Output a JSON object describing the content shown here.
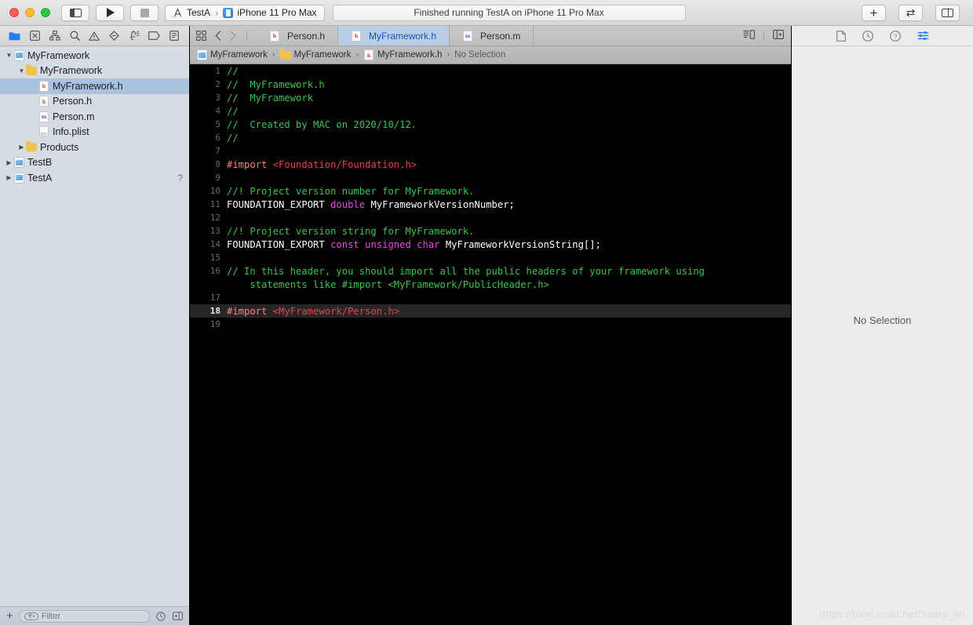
{
  "titlebar": {
    "traffic_lights": [
      "close",
      "minimize",
      "maximize"
    ],
    "sidebar_toggle_icon": "left-panel-icon",
    "run_button_label": "Run",
    "stop_button_label": "Stop",
    "scheme": {
      "project": "TestA",
      "separator": "›",
      "destination": "iPhone 11 Pro Max",
      "project_icon": "xcode-project-icon",
      "destination_icon": "simulator-icon"
    },
    "status": "Finished running TestA on iPhone 11 Pro Max",
    "add_button": "+",
    "swap_button": "⇄",
    "right_panel_toggle_icon": "right-panel-icon"
  },
  "navigator": {
    "toolbar_icons": [
      "project-navigator-icon",
      "source-control-navigator-icon",
      "symbol-navigator-icon",
      "find-navigator-icon",
      "issue-navigator-icon",
      "test-navigator-icon",
      "debug-navigator-icon",
      "breakpoint-navigator-icon",
      "report-navigator-icon"
    ],
    "tree": [
      {
        "label": "MyFramework",
        "icon": "project-icon",
        "indent": 0,
        "twist": "open",
        "selected": false,
        "badge": ""
      },
      {
        "label": "MyFramework",
        "icon": "folder-icon",
        "indent": 1,
        "twist": "open",
        "selected": false,
        "badge": ""
      },
      {
        "label": "MyFramework.h",
        "icon": "header-file-icon",
        "indent": 2,
        "twist": "none",
        "selected": true,
        "badge": ""
      },
      {
        "label": "Person.h",
        "icon": "header-file-icon",
        "indent": 2,
        "twist": "none",
        "selected": false,
        "badge": ""
      },
      {
        "label": "Person.m",
        "icon": "impl-file-icon",
        "indent": 2,
        "twist": "none",
        "selected": false,
        "badge": ""
      },
      {
        "label": "Info.plist",
        "icon": "plist-file-icon",
        "indent": 2,
        "twist": "none",
        "selected": false,
        "badge": ""
      },
      {
        "label": "Products",
        "icon": "folder-icon",
        "indent": 1,
        "twist": "closed",
        "selected": false,
        "badge": ""
      },
      {
        "label": "TestB",
        "icon": "project-icon",
        "indent": 0,
        "twist": "closed",
        "selected": false,
        "badge": ""
      },
      {
        "label": "TestA",
        "icon": "project-icon",
        "indent": 0,
        "twist": "closed",
        "selected": false,
        "badge": "?"
      }
    ],
    "filter": {
      "add_label": "+",
      "placeholder": "Filter",
      "value": "",
      "recent_icon": "recent-filter-icon",
      "sourcecontrol_icon": "source-control-filter-icon"
    }
  },
  "editor": {
    "tab_icons": [
      "grid-view-icon",
      "back-chevron-icon",
      "forward-chevron-icon"
    ],
    "tabs": [
      {
        "label": "Person.h",
        "icon": "header-file-icon",
        "active": false
      },
      {
        "label": "MyFramework.h",
        "icon": "header-file-icon",
        "active": true
      },
      {
        "label": "Person.m",
        "icon": "impl-file-icon",
        "active": false
      }
    ],
    "tab_right_icons": [
      "minimap-icon",
      "add-editor-icon"
    ],
    "breadcrumb": [
      {
        "label": "MyFramework",
        "icon": "project-icon"
      },
      {
        "label": "MyFramework",
        "icon": "folder-icon"
      },
      {
        "label": "MyFramework.h",
        "icon": "header-file-icon"
      },
      {
        "label": "No Selection",
        "icon": ""
      }
    ],
    "breadcrumb_separator": "›",
    "current_line": 18,
    "lines": [
      {
        "n": 1,
        "tokens": [
          {
            "t": "//",
            "c": "c-cm"
          }
        ]
      },
      {
        "n": 2,
        "tokens": [
          {
            "t": "//  MyFramework.h",
            "c": "c-cm"
          }
        ]
      },
      {
        "n": 3,
        "tokens": [
          {
            "t": "//  MyFramework",
            "c": "c-cm"
          }
        ]
      },
      {
        "n": 4,
        "tokens": [
          {
            "t": "//",
            "c": "c-cm"
          }
        ]
      },
      {
        "n": 5,
        "tokens": [
          {
            "t": "//  Created by MAC on 2020/10/12.",
            "c": "c-cm"
          }
        ]
      },
      {
        "n": 6,
        "tokens": [
          {
            "t": "//",
            "c": "c-cm"
          }
        ]
      },
      {
        "n": 7,
        "tokens": []
      },
      {
        "n": 8,
        "tokens": [
          {
            "t": "#import ",
            "c": "c-dm"
          },
          {
            "t": "<Foundation/Foundation.h>",
            "c": "c-str"
          }
        ]
      },
      {
        "n": 9,
        "tokens": []
      },
      {
        "n": 10,
        "tokens": [
          {
            "t": "//! Project version number for MyFramework.",
            "c": "c-cm"
          }
        ]
      },
      {
        "n": 11,
        "tokens": [
          {
            "t": "FOUNDATION_EXPORT ",
            "c": "c-id"
          },
          {
            "t": "double ",
            "c": "c-kw"
          },
          {
            "t": "MyFrameworkVersionNumber;",
            "c": "c-id"
          }
        ]
      },
      {
        "n": 12,
        "tokens": []
      },
      {
        "n": 13,
        "tokens": [
          {
            "t": "//! Project version string for MyFramework.",
            "c": "c-cm"
          }
        ]
      },
      {
        "n": 14,
        "tokens": [
          {
            "t": "FOUNDATION_EXPORT ",
            "c": "c-id"
          },
          {
            "t": "const unsigned char ",
            "c": "c-kw"
          },
          {
            "t": "MyFrameworkVersionString[];",
            "c": "c-id"
          }
        ]
      },
      {
        "n": 15,
        "tokens": []
      },
      {
        "n": 16,
        "tokens": [
          {
            "t": "// In this header, you should import all the public headers of your framework using",
            "c": "c-cm"
          }
        ]
      },
      {
        "n": "",
        "tokens": [
          {
            "t": "    statements like #import <MyFramework/PublicHeader.h>",
            "c": "c-cm"
          }
        ]
      },
      {
        "n": 17,
        "tokens": []
      },
      {
        "n": 18,
        "tokens": [
          {
            "t": "#import ",
            "c": "c-dm"
          },
          {
            "t": "<MyFramework/Person.h>",
            "c": "c-str"
          }
        ]
      },
      {
        "n": 19,
        "tokens": []
      }
    ]
  },
  "inspector": {
    "tabs": [
      {
        "icon": "file-inspector-icon",
        "active": false
      },
      {
        "icon": "history-inspector-icon",
        "active": false
      },
      {
        "icon": "help-inspector-icon",
        "active": false
      },
      {
        "icon": "quick-help-inspector-icon",
        "active": true
      }
    ],
    "empty_message": "No Selection"
  },
  "watermark": "https://blog.csdn.net/henry_lei",
  "colors": {
    "accent_blue": "#2b7cf0",
    "active_tab_bg": "#b9cde5",
    "selected_row_bg": "#a8c2e0",
    "editor_bg": "#000000",
    "current_line_bg": "#262626",
    "comment_green": "#3ec14e",
    "string_red": "#e8414a",
    "keyword_magenta": "#e24de0",
    "directive_pink": "#f98181"
  }
}
